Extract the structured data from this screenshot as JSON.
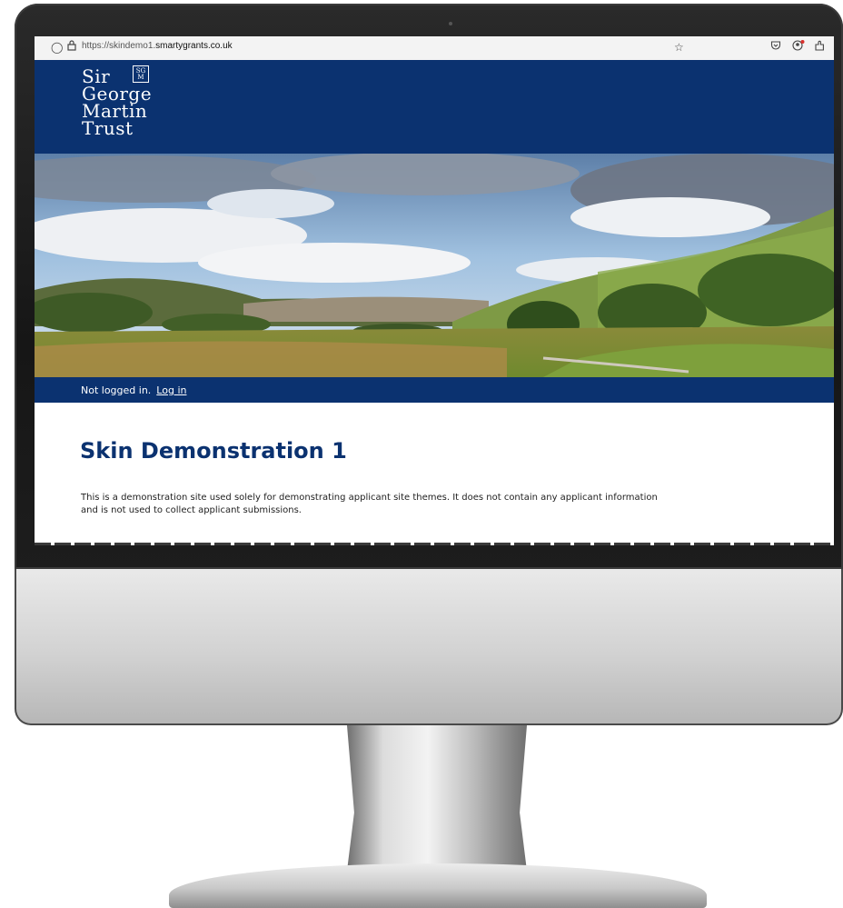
{
  "browser": {
    "url_prefix": "https://skindemo1.",
    "url_host": "smartygrants.co.uk",
    "icons": [
      "shield-icon",
      "lock-icon",
      "bookmark-star-icon",
      "pocket-icon",
      "account-icon",
      "extensions-icon"
    ]
  },
  "header": {
    "logo_lines": [
      "Sir",
      "George",
      "Martin",
      "Trust"
    ],
    "logo_mark": "SG\nM",
    "background": "#0b3270"
  },
  "hero": {
    "description": "hero image"
  },
  "login_bar": {
    "status": "Not logged in.",
    "login_link": "Log in"
  },
  "main": {
    "title": "Skin Demonstration 1",
    "description": "This is a demonstration site used solely for demonstrating applicant site themes. It does not contain any applicant information and is not used to collect applicant submissions."
  },
  "colors": {
    "brand_navy": "#0b3270",
    "title_blue": "#0b3270"
  }
}
